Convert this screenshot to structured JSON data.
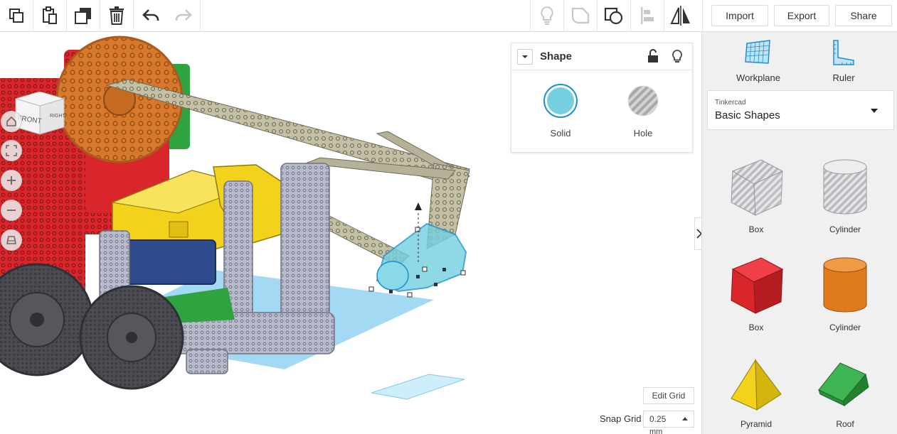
{
  "toolbar": {
    "import_label": "Import",
    "export_label": "Export",
    "share_label": "Share"
  },
  "viewcube": {
    "front": "FRONT",
    "right": "RIGHT"
  },
  "shape_panel": {
    "title": "Shape",
    "solid_label": "Solid",
    "hole_label": "Hole",
    "solid_color": "#74cfe0"
  },
  "sidebar": {
    "workplane_label": "Workplane",
    "ruler_label": "Ruler",
    "library_source": "Tinkercad",
    "library_name": "Basic Shapes",
    "shapes": [
      {
        "label": "Box"
      },
      {
        "label": "Cylinder"
      },
      {
        "label": "Box"
      },
      {
        "label": "Cylinder"
      },
      {
        "label": "Pyramid"
      },
      {
        "label": "Roof"
      }
    ]
  },
  "grid": {
    "edit_label": "Edit Grid",
    "snap_label": "Snap Grid",
    "snap_value": "0.25",
    "snap_unit": "mm"
  },
  "colors": {
    "accent_blue": "#1f8fcf",
    "red_part": "#d8262b",
    "orange_part": "#e07a1f",
    "yellow_part": "#f2d21b",
    "green_part": "#30a341"
  }
}
